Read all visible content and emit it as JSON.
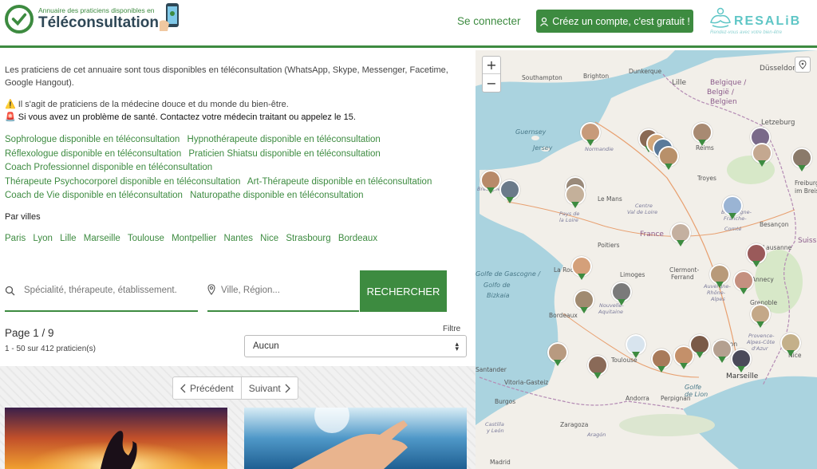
{
  "header": {
    "logo_small": "Annuaire des praticiens disponibles en",
    "logo_big": "Téléconsultation",
    "login": "Se connecter",
    "signup": "Créez un compte, c'est gratuit !",
    "brand": "RESALiB",
    "brand_tagline": "Rendez-vous avec votre bien-être"
  },
  "intro": "Les praticiens de cet annuaire sont tous disponibles en téléconsultation (WhatsApp, Skype, Messenger, Facetime, Google Hangout).",
  "note1": "⚠️ Il s'agit de praticiens de la médecine douce et du monde du bien-être.",
  "note2": "🚨 Si vous avez un problème de santé. Contactez votre médecin traitant ou appelez le 15.",
  "specialty_links": [
    "Sophrologue disponible en téléconsultation",
    "Hypnothérapeute disponible en téléconsultation",
    "Réflexologue disponible en téléconsultation",
    "Praticien Shiatsu disponible en téléconsultation",
    "Coach Professionnel disponible en téléconsultation",
    "Thérapeute Psychocorporel disponible en téléconsultation",
    "Art-Thérapeute disponible en téléconsultation",
    "Coach de Vie disponible en téléconsultation",
    "Naturopathe disponible en téléconsultation"
  ],
  "villes_title": "Par villes",
  "villes": [
    "Paris",
    "Lyon",
    "Lille",
    "Marseille",
    "Toulouse",
    "Montpellier",
    "Nantes",
    "Nice",
    "Strasbourg",
    "Bordeaux"
  ],
  "search": {
    "specialty_placeholder": "Spécialité, thérapeute, établissement.",
    "location_placeholder": "Ville, Région...",
    "button": "RECHERCHER"
  },
  "pagination": {
    "page_info": "Page 1 / 9",
    "results": "1 - 50 sur 412 praticien(s)",
    "prev": "Précédent",
    "next": "Suivant"
  },
  "filter": {
    "label": "Filtre",
    "selected": "Aucun"
  },
  "map": {
    "zoom_in": "+",
    "zoom_out": "−",
    "labels": [
      {
        "text": "Southampton"
      },
      {
        "text": "Brighton"
      },
      {
        "text": "Dunkerque"
      },
      {
        "text": "Lille"
      },
      {
        "text": "Düsseldorf"
      },
      {
        "text": "Belgique /"
      },
      {
        "text": "België /"
      },
      {
        "text": "Belgien"
      },
      {
        "text": "Guernsey"
      },
      {
        "text": "Jersey"
      },
      {
        "text": "Normandie"
      },
      {
        "text": "Reims"
      },
      {
        "text": "Letzeburg"
      },
      {
        "text": "Freiburg"
      },
      {
        "text": "im Breisgau"
      },
      {
        "text": "Le Mans"
      },
      {
        "text": "Troyes"
      },
      {
        "text": "Pays de"
      },
      {
        "text": "la Loire"
      },
      {
        "text": "Centre"
      },
      {
        "text": "Val de Loire"
      },
      {
        "text": "Bourgogne-"
      },
      {
        "text": "Franche-"
      },
      {
        "text": "Comté"
      },
      {
        "text": "Besançon"
      },
      {
        "text": "France"
      },
      {
        "text": "Poitiers"
      },
      {
        "text": "Suiss"
      },
      {
        "text": "La Roche"
      },
      {
        "text": "Limoges"
      },
      {
        "text": "Clermont-"
      },
      {
        "text": "Ferrand"
      },
      {
        "text": "Auvergne-"
      },
      {
        "text": "Rhône-"
      },
      {
        "text": "Alpes"
      },
      {
        "text": "Golfe de Gascogne /"
      },
      {
        "text": "Golfo de"
      },
      {
        "text": "Bizkaia"
      },
      {
        "text": "Bordeaux"
      },
      {
        "text": "Nouvelle-"
      },
      {
        "text": "Aquitaine"
      },
      {
        "text": "Grenoble"
      },
      {
        "text": "Provence-"
      },
      {
        "text": "Alpes-Côte"
      },
      {
        "text": "d'Azur"
      },
      {
        "text": "Toulouse"
      },
      {
        "text": "Marseille"
      },
      {
        "text": "Santander"
      },
      {
        "text": "Vitoria-Gasteiz"
      },
      {
        "text": "Burgos"
      },
      {
        "text": "Andorra"
      },
      {
        "text": "Perpignan"
      },
      {
        "text": "Zaragoza"
      },
      {
        "text": "Castilla"
      },
      {
        "text": "y León"
      },
      {
        "text": "Madrid"
      },
      {
        "text": "Nice"
      },
      {
        "text": "Lausanne"
      },
      {
        "text": "Annecy"
      },
      {
        "text": "Avignon"
      },
      {
        "text": "Golfe"
      },
      {
        "text": "de Lion"
      },
      {
        "text": "Aragón"
      },
      {
        "text": "Bretagne"
      }
    ]
  }
}
